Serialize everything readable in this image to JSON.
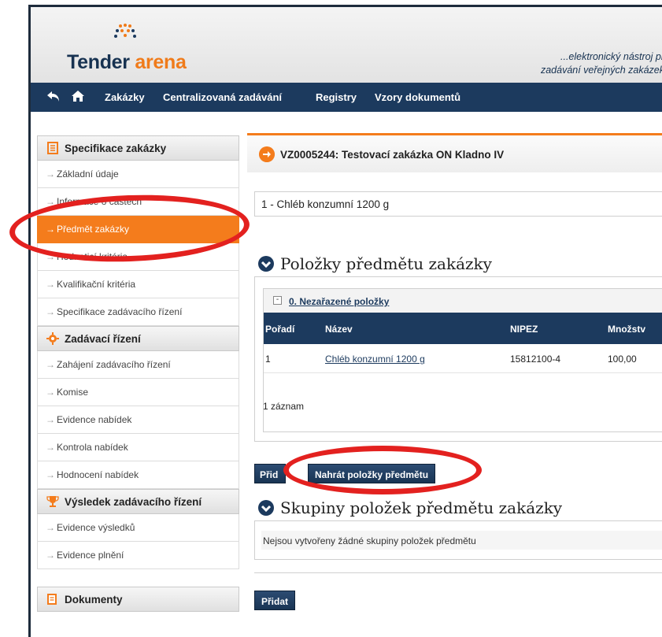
{
  "header": {
    "logo_primary": "Tender",
    "logo_accent": "arena",
    "tagline_line1": "...elektronický nástroj pr",
    "tagline_line2": "zadávání veřejných zakázek"
  },
  "nav": {
    "back_icon": "back-arrow-icon",
    "home_icon": "home-icon",
    "items": [
      "Zakázky",
      "Centralizovaná zadávání",
      "Registry",
      "Vzory dokumentů"
    ]
  },
  "sidebar": {
    "sections": [
      {
        "title": "Specifikace zakázky",
        "icon": "document-icon",
        "items": [
          "Základní údaje",
          "Informace o částech",
          "Předmět zakázky",
          "Hodnoticí kritéria",
          "Kvalifikační kritéria",
          "Specifikace zadávacího řízení"
        ]
      },
      {
        "title": "Zadávací řízení",
        "icon": "gear-icon",
        "items": [
          "Zahájení zadávacího řízení",
          "Komise",
          "Evidence nabídek",
          "Kontrola nabídek",
          "Hodnocení nabídek"
        ]
      },
      {
        "title": "Výsledek zadávacího řízení",
        "icon": "trophy-icon",
        "items": [
          "Evidence výsledků",
          "Evidence plnění"
        ]
      },
      {
        "title": "Dokumenty",
        "icon": "documents-icon",
        "items": []
      }
    ],
    "active_item": "Předmět zakázky"
  },
  "main": {
    "title": "VZ0005244: Testovací zakázka ON Kladno IV",
    "part_selected": "1 - Chléb konzumní 1200 g",
    "items_section": {
      "title": "Položky předmětu zakázky",
      "group_label": "0. Nezařazené položky",
      "columns": [
        "Pořadí",
        "Název",
        "NIPEZ",
        "Množstv"
      ],
      "rows": [
        {
          "order": "1",
          "name": "Chléb konzumní 1200 g",
          "nipez": "15812100-4",
          "qty": "100,00"
        }
      ],
      "count": "1 záznam"
    },
    "buttons": {
      "add_partial": "Přid",
      "upload": "Nahrát položky předmětu",
      "add": "Přidat"
    },
    "groups_section": {
      "title": "Skupiny položek předmětu zakázky",
      "empty": "Nejsou vytvořeny žádné skupiny položek předmětu"
    }
  },
  "colors": {
    "navy": "#1c3a5e",
    "orange": "#f47c1c",
    "annotation_red": "#e3211f"
  }
}
